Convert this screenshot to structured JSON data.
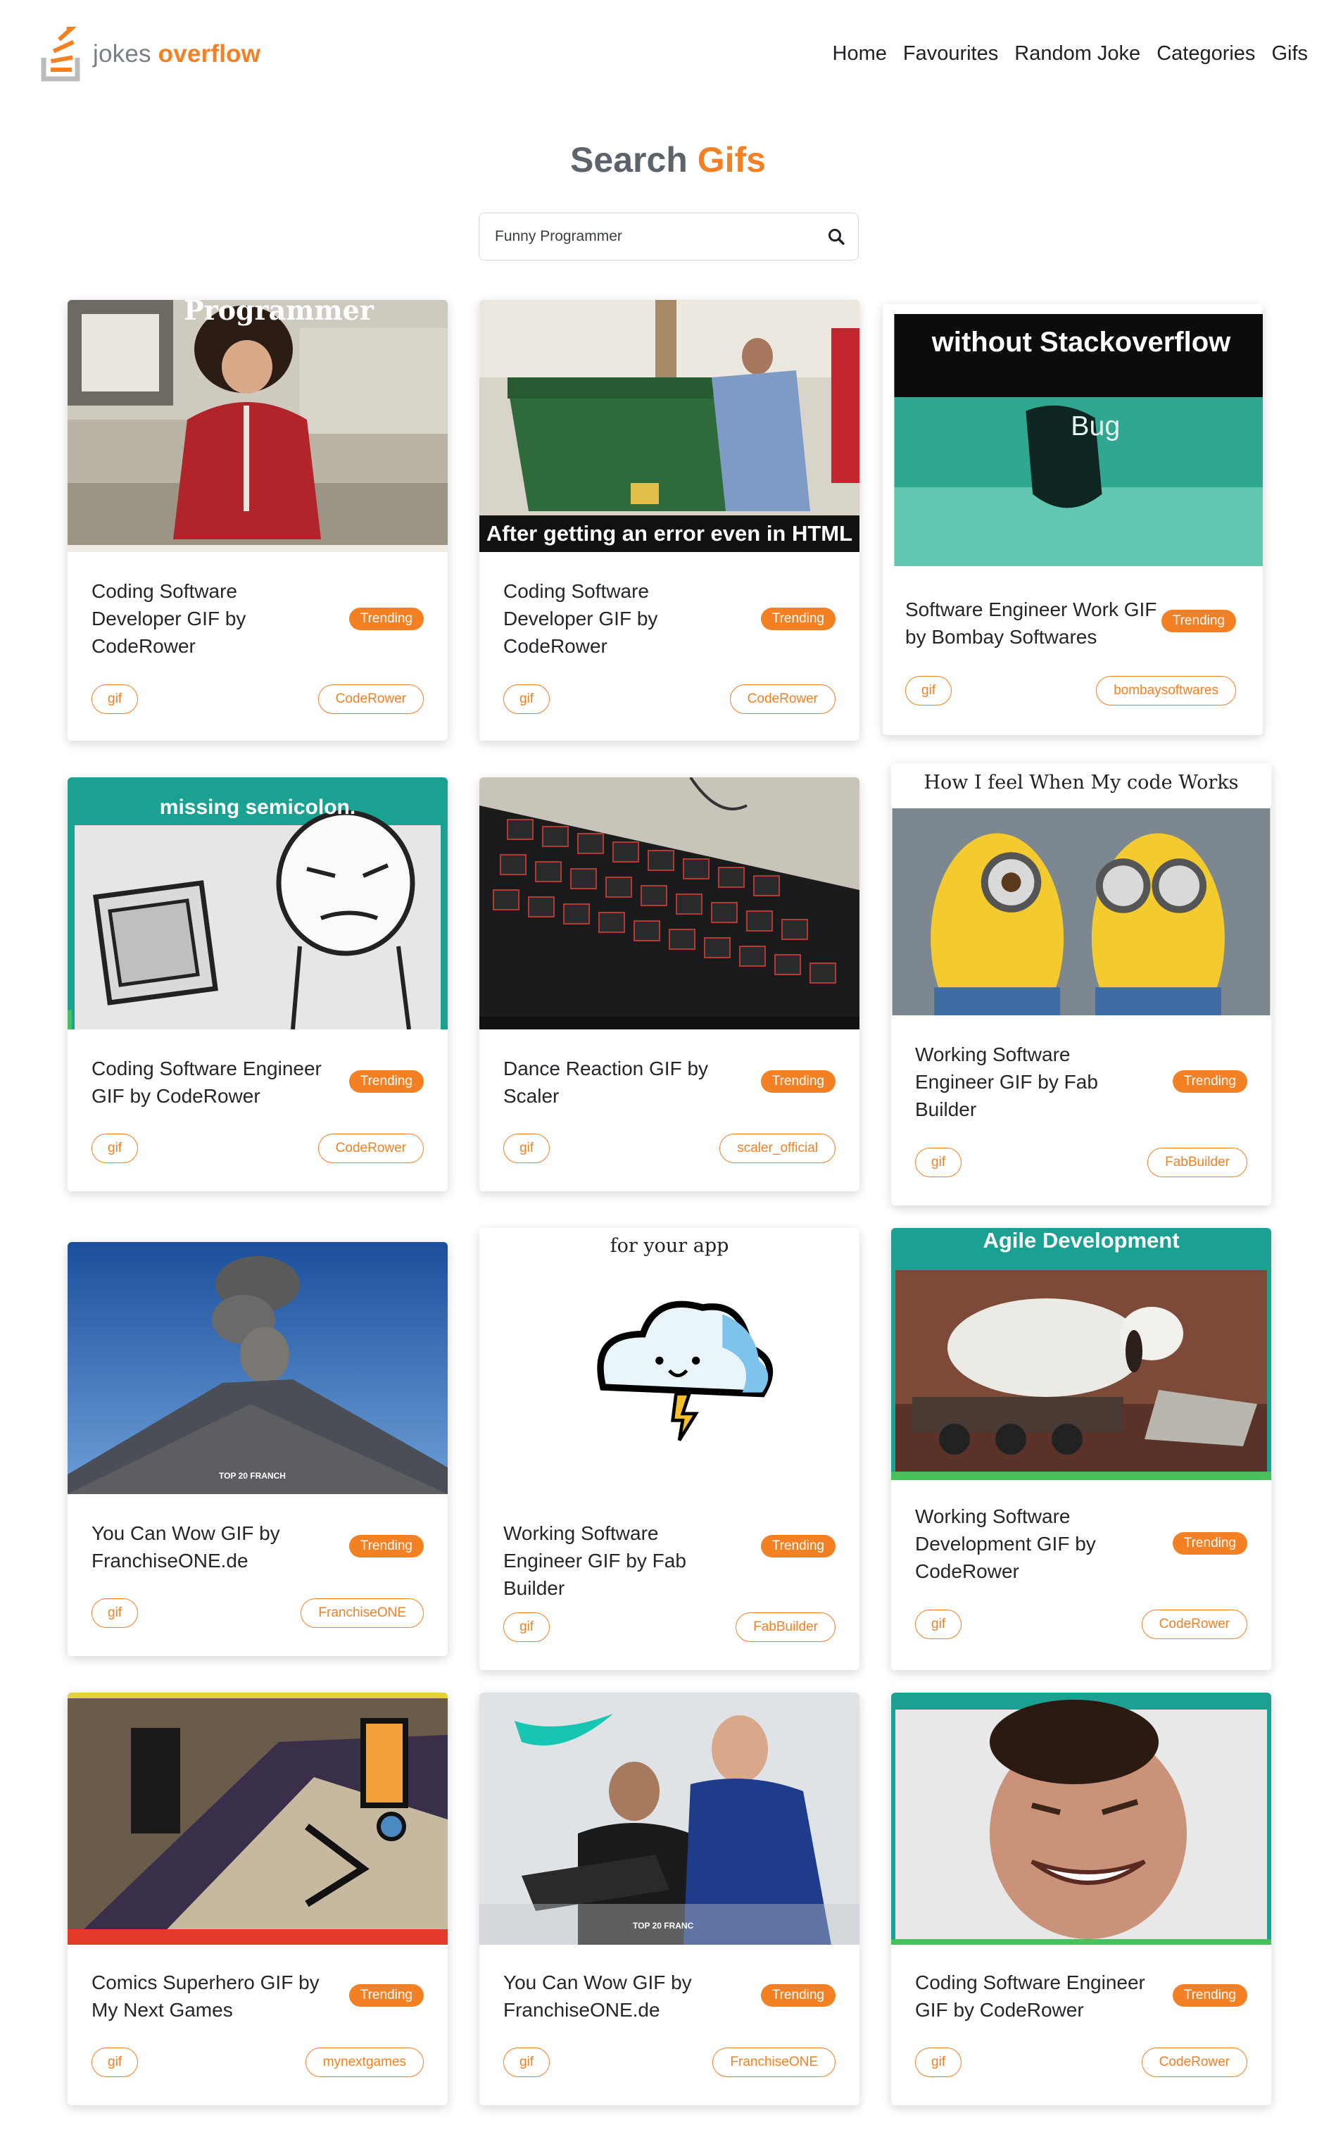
{
  "brand": {
    "part1": "jokes ",
    "part2": "overflow"
  },
  "nav": [
    "Home",
    "Favourites",
    "Random Joke",
    "Categories",
    "Gifs"
  ],
  "page_title": {
    "main": "Search ",
    "accent": "Gifs"
  },
  "search": {
    "value": "Funny Programmer",
    "icon": "search-icon"
  },
  "colors": {
    "accent": "#f48024",
    "text": "#23272b",
    "muted": "#5c636a"
  },
  "cards": [
    {
      "title": "Coding Software Developer GIF by CodeRower",
      "badge": "Trending",
      "tag": "gif",
      "user": "CodeRower",
      "thumb_text": "Programmer",
      "thumb_icon": "person-dancing-image"
    },
    {
      "title": "Coding Software Developer GIF by CodeRower",
      "badge": "Trending",
      "tag": "gif",
      "user": "CodeRower",
      "thumb_text": "After getting an error even in HTML",
      "thumb_icon": "dumpster-image"
    },
    {
      "title": "Software Engineer Work GIF by Bombay Softwares",
      "badge": "Trending",
      "tag": "gif",
      "user": "bombaysoftwares",
      "thumb_text": "without Stackoverflow",
      "thumb_icon": "bug-image"
    },
    {
      "title": "Coding Software Engineer GIF by CodeRower",
      "badge": "Trending",
      "tag": "gif",
      "user": "CodeRower",
      "thumb_text": "missing semicolon.",
      "thumb_icon": "debugging-comic-image"
    },
    {
      "title": "Dance Reaction GIF by Scaler",
      "badge": "Trending",
      "tag": "gif",
      "user": "scaler_official",
      "thumb_text": "",
      "thumb_icon": "keyboard-image"
    },
    {
      "title": "Working Software Engineer GIF by Fab Builder",
      "badge": "Trending",
      "tag": "gif",
      "user": "FabBuilder",
      "thumb_text": "How I feel When My code Works",
      "thumb_icon": "minions-image"
    },
    {
      "title": "You Can Wow GIF by FranchiseONE.de",
      "badge": "Trending",
      "tag": "gif",
      "user": "FranchiseONE",
      "thumb_text": "TOP 20 FRANCH",
      "thumb_icon": "volcano-image"
    },
    {
      "title": "Working Software Engineer GIF by Fab Builder",
      "badge": "Trending",
      "tag": "gif",
      "user": "FabBuilder",
      "thumb_text": "for your app",
      "thumb_icon": "cloud-image"
    },
    {
      "title": "Working Software Development GIF by CodeRower",
      "badge": "Trending",
      "tag": "gif",
      "user": "CodeRower",
      "thumb_text": "Agile Development",
      "thumb_icon": "dog-train-image"
    },
    {
      "title": "Comics Superhero GIF by My Next Games",
      "badge": "Trending",
      "tag": "gif",
      "user": "mynextgames",
      "thumb_text": "",
      "thumb_icon": "comic-image"
    },
    {
      "title": "You Can Wow GIF by FranchiseONE.de",
      "badge": "Trending",
      "tag": "gif",
      "user": "FranchiseONE",
      "thumb_text": "TOP 20 FRANC",
      "thumb_icon": "prosthetic-arm-image"
    },
    {
      "title": "Coding Software Engineer GIF by CodeRower",
      "badge": "Trending",
      "tag": "gif",
      "user": "CodeRower",
      "thumb_text": "",
      "thumb_icon": "laughing-man-image"
    }
  ]
}
